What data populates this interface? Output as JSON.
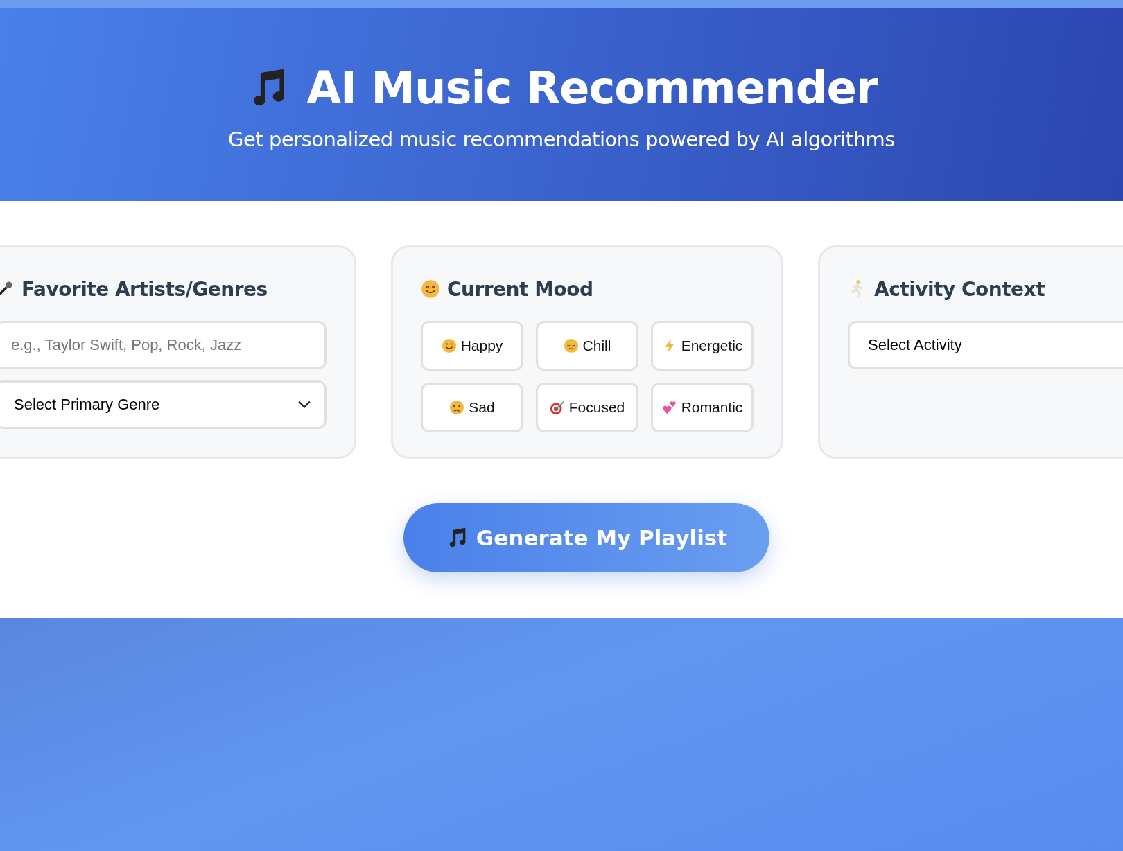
{
  "header": {
    "title": "AI Music Recommender",
    "subtitle": "Get personalized music recommendations powered by AI algorithms"
  },
  "cards": [
    {
      "kind": "artists",
      "title": "Favorite Artists/Genres",
      "input": {
        "placeholder": "e.g., Taylor Swift, Pop, Rock, Jazz"
      },
      "select": {
        "value": "Select Primary Genre"
      }
    },
    {
      "kind": "mood",
      "title": "Current Mood",
      "moods": [
        {
          "label": "Happy",
          "selected": false
        },
        {
          "label": "Chill",
          "selected": false
        },
        {
          "label": "Energetic",
          "selected": false
        },
        {
          "label": "Sad",
          "selected": false
        },
        {
          "label": "Focused",
          "selected": false
        },
        {
          "label": "Romantic",
          "selected": false
        }
      ]
    },
    {
      "kind": "activity",
      "title": "Activity Context",
      "select": {
        "value": "Select Activity"
      }
    }
  ],
  "generate_button": "Generate My Playlist"
}
